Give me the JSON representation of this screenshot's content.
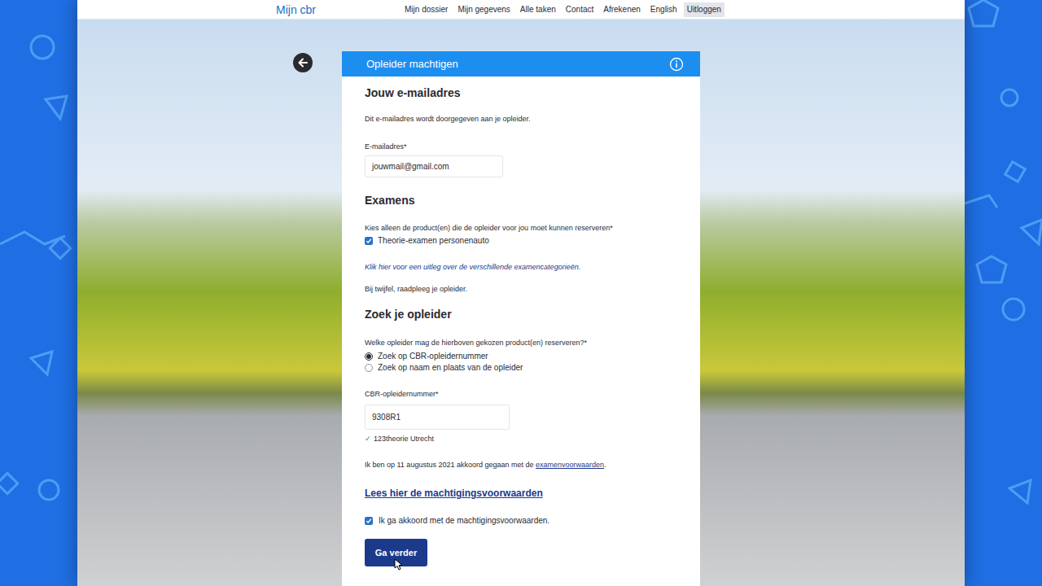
{
  "nav": {
    "logo": "Mijn cbr",
    "links": [
      {
        "label": "Mijn dossier",
        "highlighted": false
      },
      {
        "label": "Mijn gegevens",
        "highlighted": false
      },
      {
        "label": "Alle taken",
        "highlighted": false
      },
      {
        "label": "Contact",
        "highlighted": false
      },
      {
        "label": "Afrekenen",
        "highlighted": false
      },
      {
        "label": "English",
        "highlighted": false
      },
      {
        "label": "Uitloggen",
        "highlighted": true
      }
    ]
  },
  "form": {
    "title": "Opleider machtigen",
    "email": {
      "heading": "Jouw e-mailadres",
      "note": "Dit e-mailadres wordt doorgegeven aan je opleider.",
      "label": "E-mailadres*",
      "value": "jouwmail@gmail.com"
    },
    "exams": {
      "heading": "Examens",
      "prompt": "Kies alleen de product(en) die de opleider voor jou moet kunnen reserveren*",
      "options": [
        {
          "label": "Theorie-examen personenauto",
          "checked": true
        }
      ],
      "help_link": "Klik hier voor een uitleg over de verschillende examencategorieën.",
      "hint": "Bij twijfel, raadpleeg je opleider."
    },
    "instructor": {
      "heading": "Zoek je opleider",
      "prompt": "Welke opleider mag de hierboven gekozen product(en) reserveren?*",
      "search_modes": [
        {
          "label": "Zoek op CBR-opleidernummer",
          "selected": true
        },
        {
          "label": "Zoek op naam en plaats van de opleider",
          "selected": false
        }
      ],
      "number_label": "CBR-opleidernummer*",
      "number_value": "9308R1",
      "match": {
        "check": "✓",
        "name": "123theorie Utrecht"
      }
    },
    "exam_terms": {
      "before": "Ik ben op 11 augustus 2021 akkoord gegaan met de ",
      "link": "examenvoorwaarden",
      "after": "."
    },
    "terms_link": "Lees hier de machtigingsvoorwaarden",
    "agree": {
      "label": "Ik ga akkoord met de machtigingsvoorwaarden.",
      "checked": true
    },
    "submit": "Ga verder"
  }
}
